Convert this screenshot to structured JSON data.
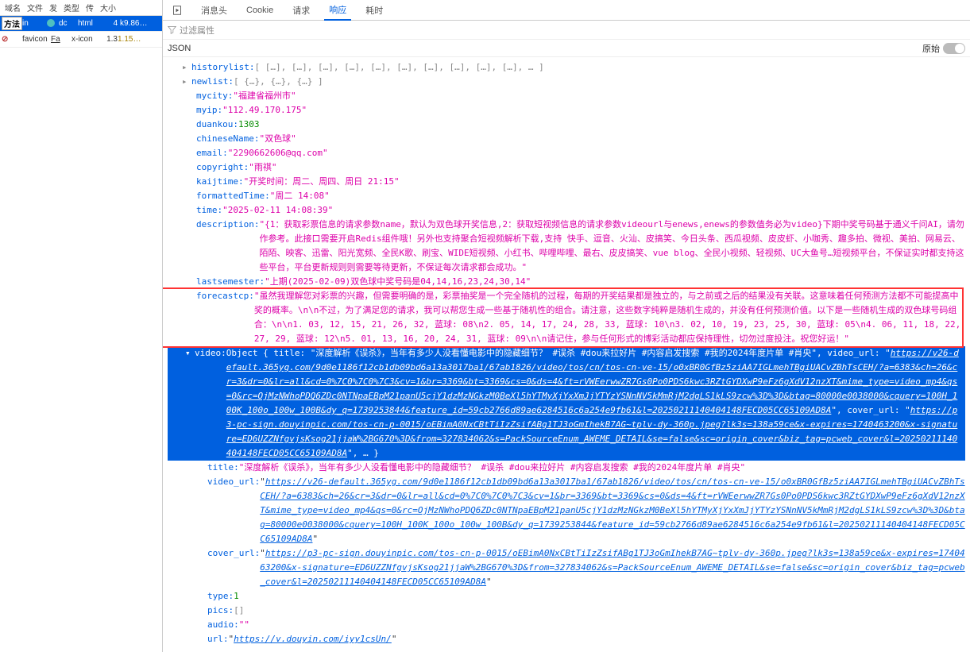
{
  "left": {
    "headers": [
      "域名",
      "文件",
      "发",
      "类型",
      "传",
      "大小"
    ],
    "method_label": "方法",
    "rows": [
      {
        "c1": "in",
        "icon": "teal",
        "c3": "dc",
        "c4": "html",
        "c5": "",
        "c6": "4 k",
        "c7": "9.86…",
        "sel": true
      },
      {
        "c1": "",
        "icon": "slash",
        "c3": "favicon",
        "c4": "Fa",
        "ext": "x-icon",
        "c5": "",
        "c6": "1.3",
        "c7": "1.15…",
        "sel": false
      }
    ]
  },
  "tabs": {
    "items": [
      "消息头",
      "Cookie",
      "请求",
      "响应",
      "耗时"
    ],
    "active_index": 3
  },
  "filter_placeholder": "过滤属性",
  "json_label": "JSON",
  "raw_label": "原始",
  "props": {
    "historylist_summary": "[ […], […], […], […], […], […], […], […], […], […], … ]",
    "newlist_summary": "[ {…}, {…}, {…} ]",
    "mycity": "福建省福州市",
    "myip": "112.49.170.175",
    "duankou": 1303,
    "chineseName": "双色球",
    "email": "2290662606@qq.com",
    "copyright": "雨祺",
    "kaijtime": "开奖时间：周二、周四、周日 21:15",
    "formattedTime": "周二 14:08",
    "time": "2025-02-11 14:08:39",
    "description": "{1：获取彩票信息的请求参数name，默认为双色球开奖信息,2：获取短视频信息的请求参数videourl与enews,enews的参数值务必为video}下期中奖号码基于通义千问AI，请勿作参考。此接口需要开启Redis组件哦！另外也支持聚合短视频解析下载,支持 快手、逗音、火汕、皮搞笑、今日头条、西瓜视频、皮皮虾、小咖秀、趣多拍、微视、美拍、网易云、陌陌、映客、迅雷、阳光宽频、全民K歌、刷宝、WIDE短视频、小红书、哔哩哔哩、最右、皮皮搞笑、vue blog、全民小视频、轻视频、UC大鱼号…短视频平台，不保证实时都支持这些平台，平台更新规则则需要等待更新，不保证每次请求都会成功。",
    "lastsemester": "上期(2025-02-09)双色球中奖号码是04,14,16,23,24,30,14",
    "forecastcp": "虽然我理解您对彩票的兴趣，但需要明确的是，彩票抽奖是一个完全随机的过程，每期的开奖结果都是独立的，与之前或之后的结果没有关联。这意味着任何预测方法都不可能提高中奖的概率。\\n\\n不过，为了满足您的请求，我可以帮您生成一些基于随机性的组合。请注意，这些数字纯粹是随机生成的，并没有任何预测价值。以下是一些随机生成的双色球号码组合：\\n\\n1. 03, 12, 15, 21, 26, 32, 蓝球: 08\\n2. 05, 14, 17, 24, 28, 33, 蓝球: 10\\n3. 02, 10, 19, 23, 25, 30, 蓝球: 05\\n4. 06, 11, 18, 22, 27, 29, 蓝球: 12\\n5. 01, 13, 16, 20, 24, 31, 蓝球: 09\\n\\n请记住，参与任何形式的博彩活动都应保持理性，切勿过度投注。祝您好运！",
    "video_object_summary": "Object { title: \"深度解析《误杀》，当年有多少人没看懂电影中的隐藏细节？ #误杀 #dou来拉好片 #内容启发搜索 #我的2024年度片单 #肖央\", video_url: ",
    "video_url_block": "https://v26-default.365yg.com/9d0e1186f12cb1db09bd6a13a3017ba1/67ab1826/video/tos/cn/tos-cn-ve-15/o0xBR0GfBz5ziAA7IGLmehTBgiUACvZBhTsCEH/?a=6383&ch=26&cr=3&dr=0&lr=all&cd=0%7C0%7C0%7C3&cv=1&br=3369&bt=3369&cs=0&ds=4&ft=rVWEerwwZR7Gs0Po0PDS6kwc3RZtGYDXwP9eFz6gXdV12nzXT&mime_type=video_mp4&qs=0&rc=OjMzNWhoPDQ6ZDc0NTNpaEBpM21panU5cjY1dzMzNGkzM0BeXl5hYTMyXjYxXmJjYTYzYSNnNV5kMmRjM2dgLS1kLS9zcw%3D%3D&btag=80000e0038000&cquery=100H_100K_100o_100w_100B&dy_q=1739253844&feature_id=59cb2766d89ae6284516c6a254e9fb61&l=20250211140404148FECD05CC65109AD8A",
    "cover_url_main": "https://p3-pc-sign.douyinpic.com/tos-cn-p-0015/oEBimA0NxCBtTiIzZsifABg1TJ3oGmIhekB7AG~tplv-dy-360p.jpeg?lk3s=138a59ce&x-expires=1740463200&x-signature=ED6UZZNfgvjsKsog21jjaW%2BG670%3D&from=327834062&s=PackSourceEnum_AWEME_DETAIL&se=false&sc=origin_cover&biz_tag=pcweb_cover&l=20250211140404148FECD05CC65109AD8A",
    "video_children": {
      "title": "深度解析《误杀》，当年有多少人没看懂电影中的隐藏细节？ #误杀 #dou来拉好片 #内容启发搜索 #我的2024年度片单 #肖央",
      "video_url": "https://v26-default.365yg.com/9d0e1186f12cb1db09bd6a13a3017ba1/67ab1826/video/tos/cn/tos-cn-ve-15/o0xBR0GfBz5ziAA7IGLmehTBgiUACvZBhTsCEH/?a=6383&ch=26&cr=3&dr=0&lr=all&cd=0%7C0%7C0%7C3&cv=1&br=3369&bt=3369&cs=0&ds=4&ft=rVWEerwwZR7Gs0Po0PDS6kwc3RZtGYDXwP9eFz6gXdV12nzXT&mime_type=video_mp4&qs=0&rc=OjMzNWhoPDQ6ZDc0NTNpaEBpM21panU5cjY1dzMzNGkzM0BeXl5hYTMyXjYxXmJjYTYzYSNnNV5kMmRjM2dgLS1kLS9zcw%3D%3D&btag=80000e0038000&cquery=100H_100K_100o_100w_100B&dy_q=1739253844&feature_id=59cb2766d89ae6284516c6a254e9fb61&l=20250211140404148FECD05CC65109AD8A",
      "cover_url": "https://p3-pc-sign.douyinpic.com/tos-cn-p-0015/oEBimA0NxCBtTiIzZsifABg1TJ3oGmIhekB7AG~tplv-dy-360p.jpeg?lk3s=138a59ce&x-expires=1740463200&x-signature=ED6UZZNfgvjsKsog21jjaW%2BG670%3D&from=327834062&s=PackSourceEnum_AWEME_DETAIL&se=false&sc=origin_cover&biz_tag=pcweb_cover&l=20250211140404148FECD05CC65109AD8A",
      "type": 1,
      "pics": "[]",
      "audio": "",
      "url": "https://v.douyin.com/iyy1csUn/"
    }
  }
}
